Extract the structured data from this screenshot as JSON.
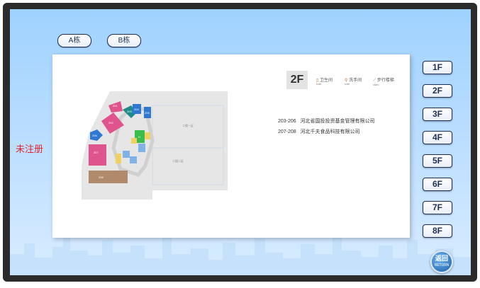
{
  "tabs": [
    {
      "label": "A栋"
    },
    {
      "label": "B栋"
    }
  ],
  "floors": [
    "1F",
    "2F",
    "3F",
    "4F",
    "5F",
    "6F",
    "7F",
    "8F"
  ],
  "selected_floor": "2F",
  "current_floor_badge": "2F",
  "legend": [
    {
      "label": "卫生间",
      "sub": "toilet",
      "icon": "restroom-icon"
    },
    {
      "label": "洗手间",
      "sub": "toilet",
      "icon": "people-icon"
    },
    {
      "label": "步行楼梯",
      "sub": "stairs",
      "icon": "stairs-icon"
    }
  ],
  "tenants": [
    {
      "room": "203-206",
      "name": "河北省国投投资基金管理有限公司"
    },
    {
      "room": "207-208",
      "name": "河北千夫食品科技有限公司"
    }
  ],
  "watermark": "未注册",
  "back_button": {
    "label": "返回",
    "sub": "RETURN"
  },
  "map_labels": {
    "r1": "201",
    "r2": "202",
    "r3": "203",
    "r4": "204",
    "r5": "205",
    "r6": "206",
    "r7": "207",
    "r8": "208",
    "h1": "H",
    "zone_a": "二楼一区",
    "zone_b": "二楼二区"
  },
  "colors": {
    "screen_top": "#9fd2ff",
    "panel": "#ffffff",
    "accent_pink": "#e0548e",
    "accent_blue": "#2e78d4",
    "accent_teal": "#1f8a8a",
    "accent_yellow": "#f0d060",
    "accent_brown": "#b08a6a",
    "watermark_red": "#e0262b"
  }
}
